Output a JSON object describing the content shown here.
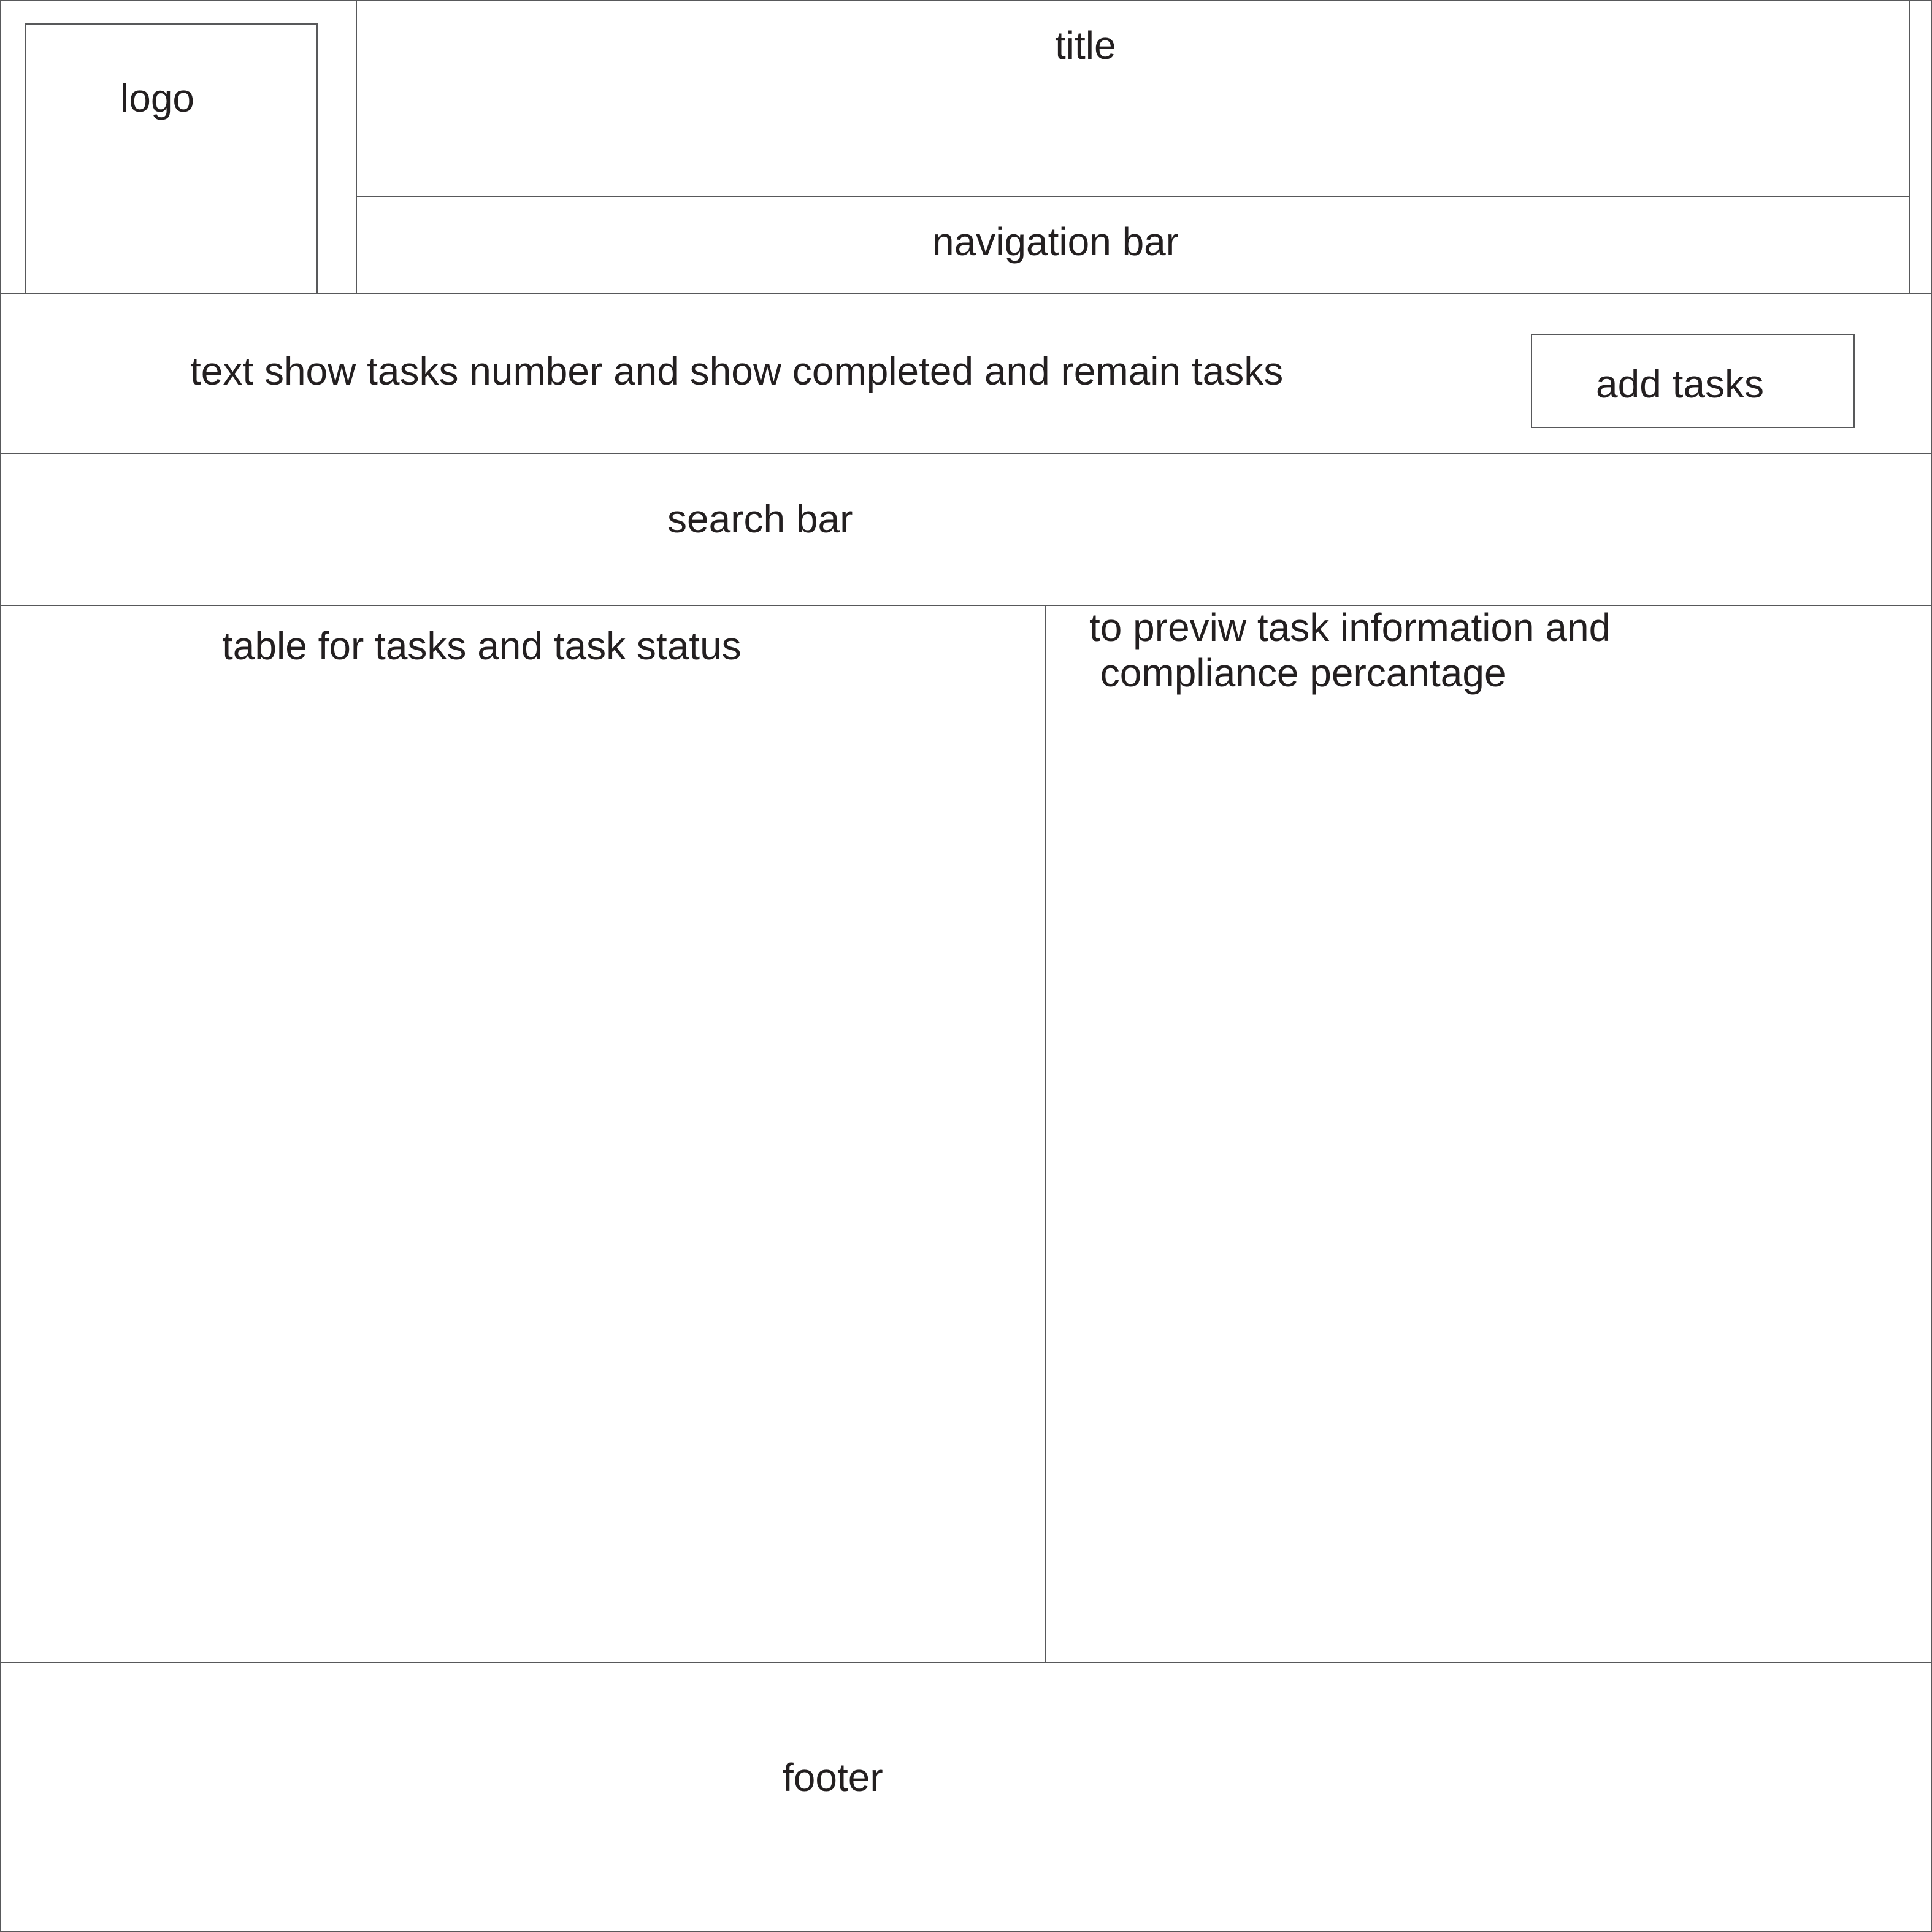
{
  "header": {
    "logo_label": "logo",
    "title_label": "title",
    "nav_label": "navigation bar"
  },
  "summary": {
    "text": "text show tasks number and show completed and remain tasks",
    "add_button_label": "add tasks"
  },
  "search": {
    "label": "search bar"
  },
  "main": {
    "table_label": "table for tasks and task status",
    "preview_label": "to previw task information and\n compliance percantage"
  },
  "footer": {
    "label": "footer"
  },
  "colors": {
    "stroke": "#58595b",
    "text": "#231f20",
    "background": "#ffffff"
  }
}
